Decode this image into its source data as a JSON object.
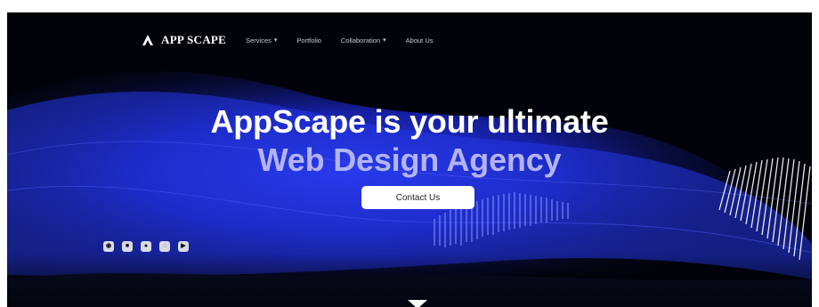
{
  "brand": {
    "name": "APP SCAPE"
  },
  "nav": [
    {
      "label": "Services",
      "has_dropdown": true
    },
    {
      "label": "Portfolio",
      "has_dropdown": false
    },
    {
      "label": "Collaboration",
      "has_dropdown": true
    },
    {
      "label": "About Us",
      "has_dropdown": false
    }
  ],
  "hero": {
    "headline_line1": "AppScape is your ultimate",
    "headline_line2": "Web Design Agency",
    "cta_label": "Contact Us"
  },
  "social_icons": [
    "instagram-icon",
    "linkedin-icon",
    "behance-icon",
    "dribbble-icon",
    "youtube-icon"
  ],
  "colors": {
    "accent": "#b3b4f6",
    "wave": "#2a3cff",
    "background": "#02030a"
  }
}
